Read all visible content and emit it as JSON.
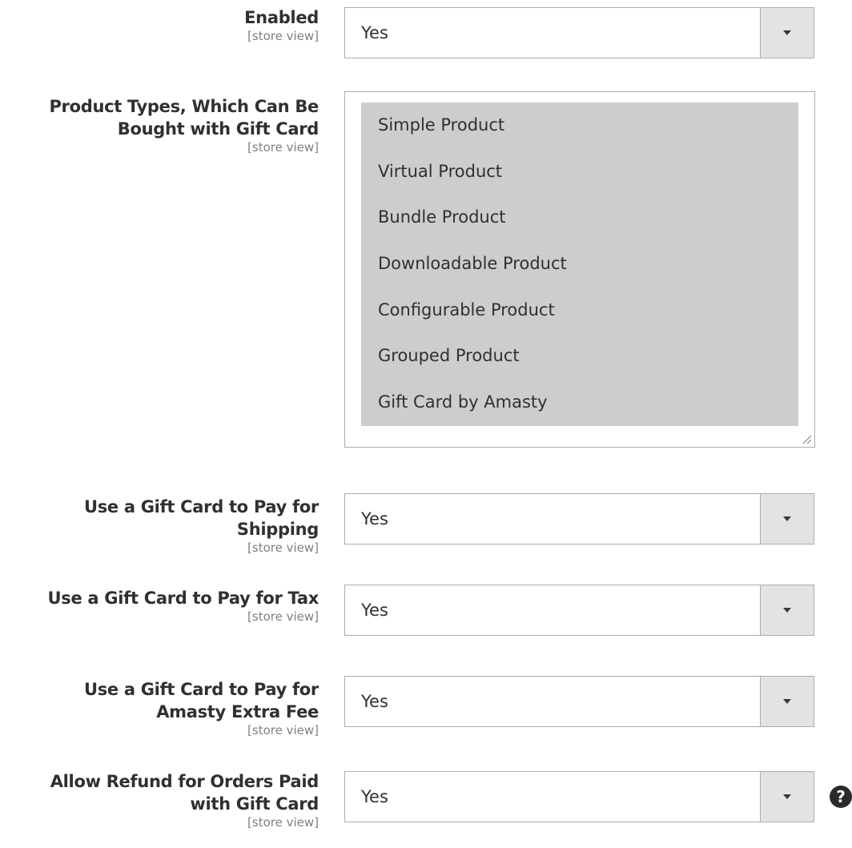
{
  "scope_label": "[store view]",
  "fields": {
    "enabled": {
      "label": "Enabled",
      "value": "Yes"
    },
    "product_types": {
      "label_line1": "Product Types, Which Can Be",
      "label_line2": "Bought with Gift Card",
      "options": [
        "Simple Product",
        "Virtual Product",
        "Bundle Product",
        "Downloadable Product",
        "Configurable Product",
        "Grouped Product",
        "Gift Card by Amasty"
      ]
    },
    "pay_shipping": {
      "label_line1": "Use a Gift Card to Pay for",
      "label_line2": "Shipping",
      "value": "Yes"
    },
    "pay_tax": {
      "label": "Use a Gift Card to Pay for Tax",
      "value": "Yes"
    },
    "pay_extra_fee": {
      "label_line1": "Use a Gift Card to Pay for",
      "label_line2": "Amasty Extra Fee",
      "value": "Yes"
    },
    "allow_refund": {
      "label_line1": "Allow Refund for Orders Paid",
      "label_line2": "with Gift Card",
      "value": "Yes"
    }
  },
  "icons": {
    "dropdown": "caret-down-icon",
    "help": "question-circle-icon",
    "resize": "resize-handle-icon"
  },
  "help_glyph": "?"
}
